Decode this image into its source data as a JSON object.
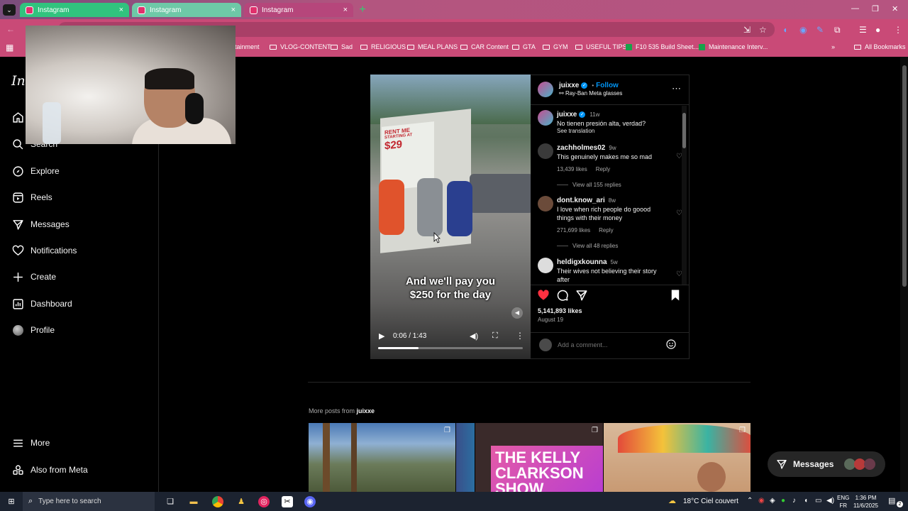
{
  "browser": {
    "tabs": [
      {
        "title": "Instagram",
        "close": "×"
      },
      {
        "title": "Instagram",
        "close": "×"
      },
      {
        "title": "Instagram",
        "close": "×"
      }
    ],
    "new_tab": "+",
    "bookmarks": [
      {
        "label": "tainment",
        "kind": "folder"
      },
      {
        "label": "VLOG-CONTENT",
        "kind": "folder"
      },
      {
        "label": "Sad",
        "kind": "folder"
      },
      {
        "label": "RELIGIOUS",
        "kind": "folder"
      },
      {
        "label": "MEAL PLANS",
        "kind": "folder"
      },
      {
        "label": "CAR Content",
        "kind": "folder"
      },
      {
        "label": "GTA",
        "kind": "folder"
      },
      {
        "label": "GYM",
        "kind": "folder"
      },
      {
        "label": "USEFUL TIPS",
        "kind": "folder"
      },
      {
        "label": "F10 535 Build Sheet...",
        "kind": "sheet"
      },
      {
        "label": "Maintenance Interv...",
        "kind": "sheet"
      }
    ],
    "all_bookmarks": "All Bookmarks",
    "overflow": "»"
  },
  "sidebar": {
    "logo": "Ins",
    "items": [
      {
        "label": "Search",
        "icon": "search-icon"
      },
      {
        "label": "Explore",
        "icon": "explore-icon"
      },
      {
        "label": "Reels",
        "icon": "reels-icon"
      },
      {
        "label": "Messages",
        "icon": "messages-icon"
      },
      {
        "label": "Notifications",
        "icon": "heart-icon"
      },
      {
        "label": "Create",
        "icon": "plus-icon"
      },
      {
        "label": "Dashboard",
        "icon": "dashboard-icon"
      },
      {
        "label": "Profile",
        "icon": "avatar"
      }
    ],
    "more": "More",
    "also_from_meta": "Also from Meta"
  },
  "post": {
    "video": {
      "sign_text": "RENT ME",
      "sign_sub": "STARTING AT",
      "sign_price": "$29",
      "caption_line1": "And we'll pay you",
      "caption_line2": "$250 for the day",
      "time": "0:06 / 1:43",
      "progress": 0.28
    },
    "header": {
      "username": "juixxe",
      "follow": "Follow",
      "separator": "•",
      "subtitle": "Ray-Ban Meta glasses"
    },
    "caption": {
      "username": "juixxe",
      "age": "11w",
      "text": "No tienen presión alta, verdad?",
      "see_translation": "See translation"
    },
    "comments": [
      {
        "username": "zachholmes02",
        "age": "9w",
        "text": "This genuinely makes me so mad",
        "likes": "13,439 likes",
        "reply": "Reply",
        "view_replies": "View all 155 replies"
      },
      {
        "username": "dont.know_ari",
        "age": "8w",
        "text": "I love when rich people do goood things with their money",
        "likes": "271,699 likes",
        "reply": "Reply",
        "view_replies": "View all 48 replies"
      },
      {
        "username": "heldigxkounna",
        "age": "5w",
        "text": "Their wives not believing their story after",
        "likes": "",
        "reply": "",
        "view_replies": ""
      }
    ],
    "likes": "5,141,893 likes",
    "date": "August 19",
    "comment_placeholder": "Add a comment..."
  },
  "more_posts": {
    "label": "More posts from",
    "username": "juixxe",
    "thumb_text": "THE KELLY CLARKSON SHOW"
  },
  "messages_button": "Messages",
  "taskbar": {
    "search_placeholder": "Type here to search",
    "weather": "18°C  Ciel couvert",
    "lang_top": "ENG",
    "lang_bottom": "FR",
    "time": "1:36 PM",
    "date": "11/6/2025",
    "notif_count": "2"
  }
}
